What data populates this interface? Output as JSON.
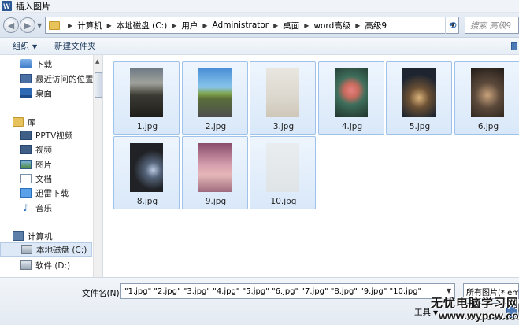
{
  "window": {
    "title": "插入图片",
    "app_icon": "W"
  },
  "address": {
    "crumbs": [
      "计算机",
      "本地磁盘 (C:)",
      "用户",
      "Administrator",
      "桌面",
      "word高级",
      "高级9"
    ],
    "search_placeholder": "搜索 高级9"
  },
  "toolbar": {
    "organize": "组织",
    "new_folder": "新建文件夹"
  },
  "nav": {
    "favorites": [
      "下载",
      "最近访问的位置",
      "桌面"
    ],
    "libraries_label": "库",
    "libraries": [
      "PPTV视频",
      "视频",
      "图片",
      "文档",
      "迅雷下载",
      "音乐"
    ],
    "computer_label": "计算机",
    "drives": [
      "本地磁盘 (C:)",
      "软件 (D:)"
    ]
  },
  "files": [
    {
      "name": "1.jpg"
    },
    {
      "name": "2.jpg"
    },
    {
      "name": "3.jpg"
    },
    {
      "name": "4.jpg"
    },
    {
      "name": "5.jpg"
    },
    {
      "name": "6.jpg"
    },
    {
      "name": "8.jpg"
    },
    {
      "name": "9.jpg"
    },
    {
      "name": "10.jpg"
    }
  ],
  "footer": {
    "filename_label": "文件名(N):",
    "filename_value": "\"1.jpg\" \"2.jpg\" \"3.jpg\" \"4.jpg\" \"5.jpg\" \"6.jpg\" \"7.jpg\" \"8.jpg\" \"9.jpg\" \"10.jpg\"",
    "filetype_value": "所有图片(*.emf;",
    "tools": "工具"
  },
  "watermark": {
    "line1": "无忧电脑学习网",
    "line2": "www.wypcw.com"
  }
}
